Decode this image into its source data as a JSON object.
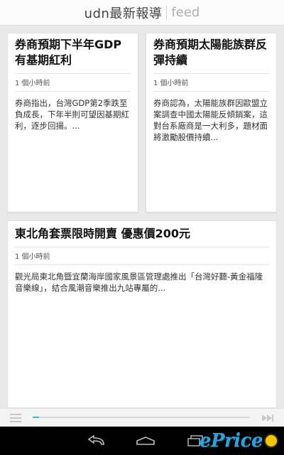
{
  "header": {
    "title": "udn最新報導",
    "subtitle": "feed"
  },
  "articles": [
    {
      "headline": "券商預期下半年GDP有基期紅利",
      "time": "1 個小時前",
      "summary": "券商指出，台灣GDP第2季跌至負成長，下年半則可望因基期紅利，逐步回揚。..."
    },
    {
      "headline": "券商預期太陽能族群反彈持續",
      "time": "1 個小時前",
      "summary": "券商認為，太陽能族群因歐盟立案調查中國太陽能反傾銷案，這對台系廠商是一大利多，題材面將激勵股價持續..."
    },
    {
      "headline": "東北角套票限時開賣 優惠價200元",
      "time": "1 個小時前",
      "summary": "觀光局東北角暨宜蘭海岸國家風景區管理處推出「台灣好聽-黃金福隆音樂線」，結合風潮音樂推出九站專屬的..."
    }
  ],
  "player": {
    "progress": 0.03,
    "accent_color": "#33b5e5",
    "menu_icon": "menu-icon",
    "next_icon": "skip-next-icon"
  },
  "navbar": {
    "icons": [
      "back-icon",
      "home-icon",
      "recent-apps-icon"
    ]
  },
  "watermark": {
    "text": "ePrice"
  }
}
